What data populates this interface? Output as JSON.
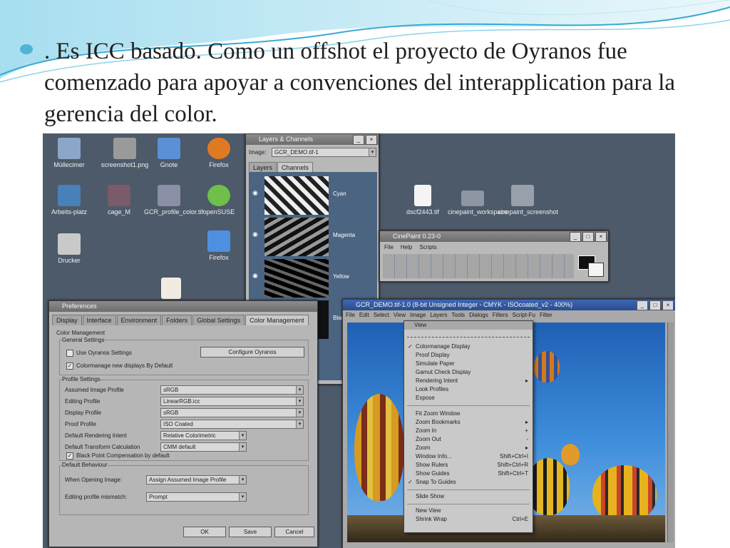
{
  "slide": {
    "text": ".   Es ICC basado. Como un offshot el proyecto de Oyranos fue comenzado para apoyar a convenciones del interapplication para la gerencia del color."
  },
  "desktop": {
    "icons": [
      {
        "label": "Müllecimer"
      },
      {
        "label": "screenshot1.png"
      },
      {
        "label": "Gnote"
      },
      {
        "label": "Firefox"
      },
      {
        "label": "Arbeits-platz"
      },
      {
        "label": "cage_M"
      },
      {
        "label": "GCR_profile_color.tif"
      },
      {
        "label": "openSUSE"
      },
      {
        "label": "Drucker"
      },
      {
        "label": "Firefox"
      },
      {
        "label": "dscf2443.tif"
      },
      {
        "label": "cinepaint_workspace"
      },
      {
        "label": "cinepaint_screenshot"
      }
    ]
  },
  "layers": {
    "title": "Layers & Channels",
    "image_label": "Image:",
    "image_value": "GCR_DEMO.tif-1",
    "tabs": [
      "Layers",
      "Channels"
    ],
    "channels": [
      "Cyan",
      "Magenta",
      "Yellow",
      "Black"
    ]
  },
  "cinepaint": {
    "title": "CinePaint 0.23-0",
    "menu": [
      "File",
      "Help",
      "Scripts"
    ]
  },
  "prefs": {
    "title": "Preferences",
    "tabs": [
      "Display",
      "Interface",
      "Environment",
      "Folders",
      "Global Settings",
      "Color Management"
    ],
    "cm_title": "Color Management",
    "general_title": "General Settings",
    "use_oyranos": "Use Oyranos Settings",
    "configure_oyranos": "Configure Oyranos",
    "colormanage_default": "Colormanage new displays By Default",
    "profile_settings": "Profile Settings",
    "rows": [
      {
        "label": "Assumed Image Profile",
        "value": "sRGB"
      },
      {
        "label": "Editing Profile",
        "value": "LinearRGB.icc"
      },
      {
        "label": "Display Profile",
        "value": "sRGB"
      },
      {
        "label": "Proof Profile",
        "value": "ISO Coated"
      },
      {
        "label": "Default Rendering Intent",
        "value": "Relative Colorimetric"
      },
      {
        "label": "Default Transform Calculation",
        "value": "CMM default"
      }
    ],
    "black_point": "Black Point Compensation by default",
    "behaviour": "Default Behaviour",
    "when_opening": "When Opening Image:",
    "when_opening_value": "Assign Assumed Image Profile",
    "mismatch": "Editing profile mismatch:",
    "mismatch_value": "Prompt",
    "ok": "OK",
    "save": "Save",
    "cancel": "Cancel"
  },
  "image_window": {
    "title": "GCR_DEMO.tif-1.0 (8-bit Unsigned Integer - CMYK - ISOcoated_v2 - 400%)",
    "menu": [
      "File",
      "Edit",
      "Select",
      "View",
      "Image",
      "Layers",
      "Tools",
      "Dialogs",
      "Filters",
      "Script-Fu",
      "Filter"
    ]
  },
  "view_menu": {
    "title": "View",
    "items": [
      {
        "label": "Colormanage Display",
        "check": true,
        "acc": ""
      },
      {
        "label": "Proof Display",
        "check": false,
        "acc": ""
      },
      {
        "label": "Simulate Paper",
        "check": false,
        "acc": ""
      },
      {
        "label": "Gamut Check Display",
        "check": false,
        "acc": ""
      },
      {
        "label": "Rendering Intent",
        "check": false,
        "acc": "▸"
      },
      {
        "label": "Look Profiles",
        "check": false,
        "acc": ""
      },
      {
        "label": "Expose",
        "check": false,
        "acc": ""
      },
      {
        "label": "Fit Zoom Window",
        "check": false,
        "acc": ""
      },
      {
        "label": "Zoom Bookmarks",
        "check": false,
        "acc": "▸"
      },
      {
        "label": "Zoom In",
        "check": false,
        "acc": "+"
      },
      {
        "label": "Zoom Out",
        "check": false,
        "acc": "-"
      },
      {
        "label": "Zoom",
        "check": false,
        "acc": "▸"
      },
      {
        "label": "Window Info...",
        "check": false,
        "acc": "Shift+Ctrl+I"
      },
      {
        "label": "Show Rulers",
        "check": false,
        "acc": "Shift+Ctrl+R"
      },
      {
        "label": "Show Guides",
        "check": false,
        "acc": "Shift+Ctrl+T"
      },
      {
        "label": "Snap To Guides",
        "check": true,
        "acc": ""
      },
      {
        "label": "Slide Show",
        "check": false,
        "acc": ""
      },
      {
        "label": "New View",
        "check": false,
        "acc": ""
      },
      {
        "label": "Shrink Wrap",
        "check": false,
        "acc": "Ctrl+E"
      }
    ]
  },
  "colors": {
    "accent": "#4fb4d6",
    "desktop": "#4d5a69",
    "sky": "#2f79c9"
  }
}
